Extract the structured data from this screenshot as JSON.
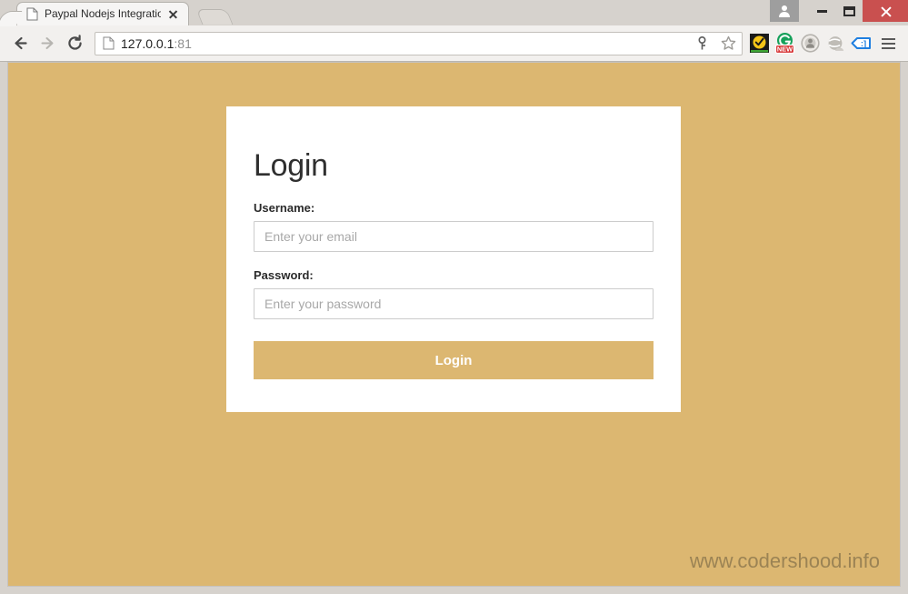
{
  "window": {
    "controls": {
      "user_label": "user-profile",
      "minimize_label": "Minimize",
      "maximize_label": "Maximize",
      "close_label": "Close"
    },
    "close_color": "#c9504f",
    "titlebar_color": "#d6d2cd"
  },
  "tab": {
    "title": "Paypal Nodejs Integration",
    "favicon": "page-icon",
    "close_label": "Close tab",
    "new_tab_label": "New tab"
  },
  "toolbar": {
    "back_label": "Back",
    "forward_label": "Forward",
    "reload_label": "Reload",
    "menu_label": "Customize and control",
    "omnibox": {
      "favicon": "page-icon",
      "host": "127.0.0.1",
      "port": ":81",
      "key_icon_label": "Saved password",
      "star_icon_label": "Bookmark this page"
    },
    "extensions": [
      {
        "name": "checkmark-extension",
        "label": "Checkmark extension",
        "badge": ""
      },
      {
        "name": "grammar-extension",
        "label": "Grammar extension",
        "badge": "NEW"
      },
      {
        "name": "person-extension",
        "label": "Account extension",
        "badge": ""
      },
      {
        "name": "globe-extension",
        "label": "Globe extension",
        "badge": ""
      },
      {
        "name": "tag-extension",
        "label": "Tag extension",
        "badge": ":]"
      }
    ]
  },
  "page": {
    "background_color": "#dcb771",
    "card": {
      "title": "Login",
      "username": {
        "label": "Username:",
        "placeholder": "Enter your email",
        "value": ""
      },
      "password": {
        "label": "Password:",
        "placeholder": "Enter your password",
        "value": ""
      },
      "submit_label": "Login",
      "submit_color": "#dcb771"
    },
    "watermark": "www.codershood.info"
  }
}
